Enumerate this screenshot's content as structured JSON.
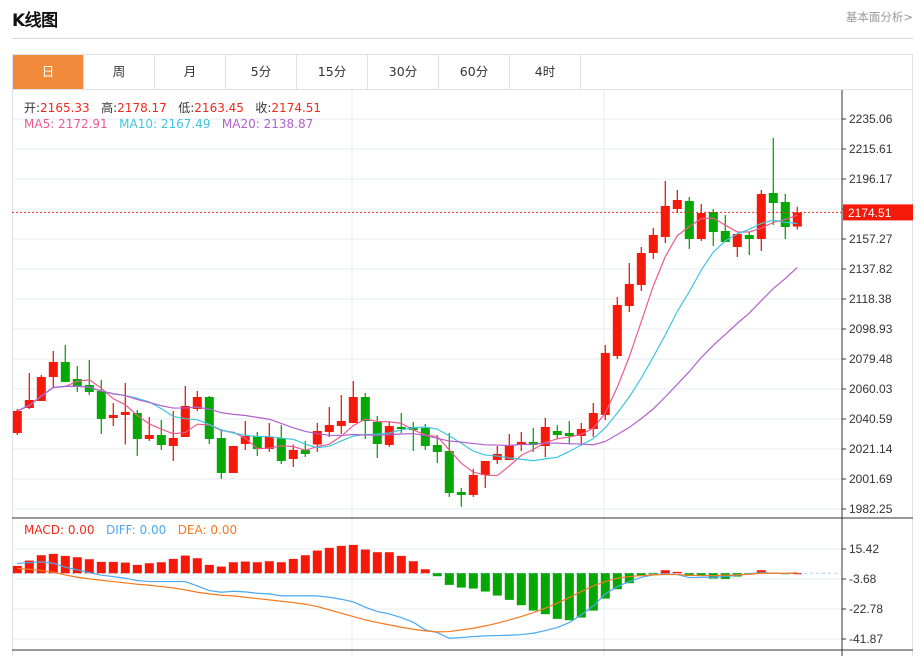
{
  "header": {
    "title": "K线图",
    "link": "基本面分析>"
  },
  "tabs": [
    {
      "label": "日",
      "active": true
    },
    {
      "label": "周"
    },
    {
      "label": "月"
    },
    {
      "label": "5分"
    },
    {
      "label": "15分"
    },
    {
      "label": "30分"
    },
    {
      "label": "60分"
    },
    {
      "label": "4时"
    }
  ],
  "ohlc_info": {
    "open_label": "开:",
    "open": "2165.33",
    "high_label": "高:",
    "high": "2178.17",
    "low_label": "低:",
    "low": "2163.45",
    "close_label": "收:",
    "close": "2174.51"
  },
  "ma_info": {
    "ma5": "MA5: 2172.91",
    "ma10": "MA10: 2167.49",
    "ma20": "MA20: 2138.87"
  },
  "macd_info": {
    "macd": "MACD: 0.00",
    "diff": "DIFF: 0.00",
    "dea": "DEA: 0.00"
  },
  "colors": {
    "up": "#f5190a",
    "down": "#05a705",
    "ma5": "#ec5b8e",
    "ma10": "#3cc6df",
    "ma20": "#b161cc",
    "diff": "#4aa8f0",
    "dea": "#f57a20",
    "accent": "#f28a3c"
  },
  "chart_data": [
    {
      "type": "candlestick",
      "y_ticks": [
        "2235.06",
        "2215.61",
        "2196.17",
        "2176.72",
        "2157.27",
        "2137.82",
        "2118.38",
        "2098.93",
        "2079.48",
        "2060.03",
        "2040.59",
        "2021.14",
        "2001.69",
        "1982.25"
      ],
      "ylim": [
        1982.25,
        2235.06
      ],
      "grid": true,
      "current_price": "2174.51",
      "ma_periods": [
        5,
        10,
        20
      ],
      "candles": [
        [
          2031.53,
          2045.79,
          2047.09,
          2030.23
        ],
        [
          2047.73,
          2052.92,
          2070.42,
          2047.09
        ],
        [
          2052.27,
          2067.83,
          2069.13,
          2052.27
        ],
        [
          2067.83,
          2077.55,
          2084.68,
          2061.35
        ],
        [
          2077.55,
          2064.59,
          2088.57,
          2064.59
        ],
        [
          2066.54,
          2062.0,
          2074.96,
          2058.11
        ],
        [
          2062.65,
          2058.11,
          2078.85,
          2056.16
        ],
        [
          2058.75,
          2040.6,
          2065.89,
          2030.88
        ],
        [
          2041.25,
          2043.2,
          2050.98,
          2036.07
        ],
        [
          2043.2,
          2045.14,
          2063.94,
          2024.05
        ],
        [
          2044.49,
          2027.64,
          2046.44,
          2016.62
        ],
        [
          2027.64,
          2030.23,
          2041.9,
          2026.34
        ],
        [
          2030.23,
          2023.75,
          2039.96,
          2020.51
        ],
        [
          2023.1,
          2028.29,
          2045.79,
          2013.38
        ],
        [
          2028.94,
          2049.03,
          2061.99,
          2028.94
        ],
        [
          2047.09,
          2054.86,
          2058.75,
          2045.79
        ],
        [
          2054.86,
          2027.64,
          2055.51,
          2024.4
        ],
        [
          2028.29,
          2005.6,
          2034.12,
          2001.71
        ],
        [
          2005.6,
          2023.1,
          2023.1,
          2005.6
        ],
        [
          2024.4,
          2029.58,
          2039.31,
          2020.51
        ],
        [
          2029.58,
          2021.16,
          2032.18,
          2016.62
        ],
        [
          2021.16,
          2028.94,
          2038.01,
          2019.21
        ],
        [
          2028.29,
          2013.38,
          2036.71,
          2011.43
        ],
        [
          2014.68,
          2020.51,
          2024.05,
          2009.49
        ],
        [
          2020.51,
          2017.92,
          2026.34,
          2015.97
        ],
        [
          2024.05,
          2032.82,
          2038.01,
          2019.21
        ],
        [
          2032.18,
          2036.71,
          2048.38,
          2028.94
        ],
        [
          2036.07,
          2039.31,
          2056.16,
          2030.88
        ],
        [
          2038.01,
          2054.86,
          2065.24,
          2038.01
        ],
        [
          2054.86,
          2039.31,
          2057.46,
          2027.64
        ],
        [
          2038.66,
          2024.4,
          2042.55,
          2015.32
        ],
        [
          2023.75,
          2036.07,
          2038.66,
          2022.45
        ],
        [
          2035.42,
          2034.12,
          2044.49,
          2031.53
        ],
        [
          2035.42,
          2033.47,
          2038.66,
          2019.86
        ],
        [
          2034.77,
          2023.1,
          2037.36,
          2020.51
        ],
        [
          2023.75,
          2019.21,
          2030.23,
          2012.08
        ],
        [
          2019.86,
          1992.64,
          2031.53,
          1990.05
        ],
        [
          1993.29,
          1991.34,
          1995.88,
          1983.68
        ],
        [
          1991.34,
          2004.3,
          2008.19,
          1990.05
        ],
        [
          2004.3,
          2013.38,
          2013.38,
          1995.88
        ],
        [
          2014.03,
          2017.92,
          2023.1,
          2011.43
        ],
        [
          2014.03,
          2023.75,
          2030.88,
          2014.03
        ],
        [
          2023.75,
          2025.7,
          2032.18,
          2019.86
        ],
        [
          2025.7,
          2023.75,
          2034.77,
          2019.21
        ],
        [
          2023.1,
          2035.42,
          2041.25,
          2015.97
        ],
        [
          2032.82,
          2030.23,
          2036.71,
          2027.64
        ],
        [
          2031.53,
          2029.58,
          2039.31,
          2024.05
        ],
        [
          2029.58,
          2034.12,
          2038.01,
          2024.05
        ],
        [
          2034.12,
          2044.49,
          2050.98,
          2028.94
        ],
        [
          2043.2,
          2083.39,
          2088.57,
          2039.96
        ],
        [
          2081.44,
          2114.5,
          2119.68,
          2079.5
        ],
        [
          2113.85,
          2128.11,
          2141.72,
          2109.96
        ],
        [
          2127.46,
          2148.2,
          2152.09,
          2123.57
        ],
        [
          2148.2,
          2159.87,
          2164.41,
          2144.32
        ],
        [
          2158.58,
          2178.67,
          2194.88,
          2154.69
        ],
        [
          2176.73,
          2182.56,
          2189.04,
          2174.13
        ],
        [
          2181.91,
          2157.28,
          2184.5,
          2150.8
        ],
        [
          2157.28,
          2174.13,
          2179.97,
          2155.98
        ],
        [
          2174.78,
          2161.82,
          2176.73,
          2152.74
        ],
        [
          2162.47,
          2155.34,
          2172.84,
          2155.34
        ],
        [
          2152.09,
          2160.52,
          2160.52,
          2145.61
        ],
        [
          2159.87,
          2157.28,
          2161.82,
          2146.91
        ],
        [
          2157.28,
          2186.45,
          2189.04,
          2149.5
        ],
        [
          2187.1,
          2180.62,
          2222.75,
          2166.35
        ],
        [
          2181.26,
          2165.06,
          2186.45,
          2157.28
        ],
        [
          2165.33,
          2174.51,
          2178.17,
          2163.45
        ]
      ]
    },
    {
      "type": "bar",
      "y_ticks": [
        "15.42",
        "-3.68",
        "-22.78",
        "-41.87"
      ],
      "grid": true,
      "macd": [
        4.67,
        8.06,
        11.46,
        12.31,
        11.03,
        10.19,
        8.91,
        7.21,
        7.21,
        6.79,
        5.31,
        6.37,
        7.0,
        9.12,
        11.25,
        9.55,
        5.31,
        4.24,
        7.0,
        7.43,
        7.0,
        7.64,
        7.0,
        9.12,
        11.46,
        14.43,
        16.13,
        17.4,
        18.04,
        15.07,
        13.37,
        13.37,
        11.03,
        7.64,
        2.55,
        -1.91,
        -7.43,
        -9.12,
        -9.76,
        -11.67,
        -14.22,
        -16.98,
        -20.37,
        -23.77,
        -26.1,
        -29.07,
        -29.92,
        -28.23,
        -23.77,
        -16.13,
        -10.19,
        -6.37,
        -1.7,
        -0.42,
        1.91,
        0.85,
        -1.7,
        -1.27,
        -3.4,
        -3.61,
        -2.12,
        -0.85,
        1.91,
        0.42,
        -0.64,
        0.0
      ],
      "diff": [
        6.15,
        6.79,
        7.21,
        6.37,
        3.82,
        2.12,
        0.42,
        -1.27,
        -2.12,
        -3.18,
        -4.67,
        -5.31,
        -5.31,
        -5.31,
        -5.31,
        -8.06,
        -11.03,
        -12.1,
        -11.46,
        -11.88,
        -12.73,
        -13.16,
        -14.43,
        -14.43,
        -14.43,
        -14.43,
        -15.28,
        -16.55,
        -18.25,
        -21.64,
        -24.4,
        -25.89,
        -28.23,
        -31.19,
        -36.07,
        -37.77,
        -41.38,
        -40.95,
        -40.32,
        -39.89,
        -39.68,
        -39.47,
        -39.04,
        -38.2,
        -36.5,
        -34.59,
        -31.41,
        -26.53,
        -20.8,
        -13.16,
        -8.49,
        -5.31,
        -2.55,
        -1.06,
        -0.42,
        -0.85,
        -2.76,
        -2.55,
        -2.55,
        -2.12,
        -1.27,
        -0.42,
        0.42,
        0.0,
        -0.21,
        0.21
      ],
      "dea": [
        2.97,
        2.55,
        1.7,
        0.64,
        -1.06,
        -2.55,
        -3.61,
        -4.46,
        -5.31,
        -6.15,
        -7.0,
        -7.64,
        -8.49,
        -9.34,
        -10.61,
        -12.1,
        -13.16,
        -14.01,
        -14.43,
        -15.28,
        -16.13,
        -16.98,
        -17.82,
        -18.67,
        -19.73,
        -21.22,
        -23.34,
        -25.46,
        -27.59,
        -29.71,
        -31.41,
        -32.89,
        -34.38,
        -35.65,
        -36.71,
        -37.35,
        -37.14,
        -36.07,
        -35.01,
        -33.53,
        -31.83,
        -29.71,
        -27.59,
        -25.04,
        -22.28,
        -19.1,
        -15.49,
        -11.67,
        -8.06,
        -5.31,
        -3.18,
        -2.12,
        -1.49,
        -1.06,
        -0.85,
        -0.85,
        -1.27,
        -1.49,
        -1.49,
        -1.27,
        -1.06,
        -0.64,
        0.0,
        0.0,
        0.0,
        0.21
      ]
    }
  ]
}
